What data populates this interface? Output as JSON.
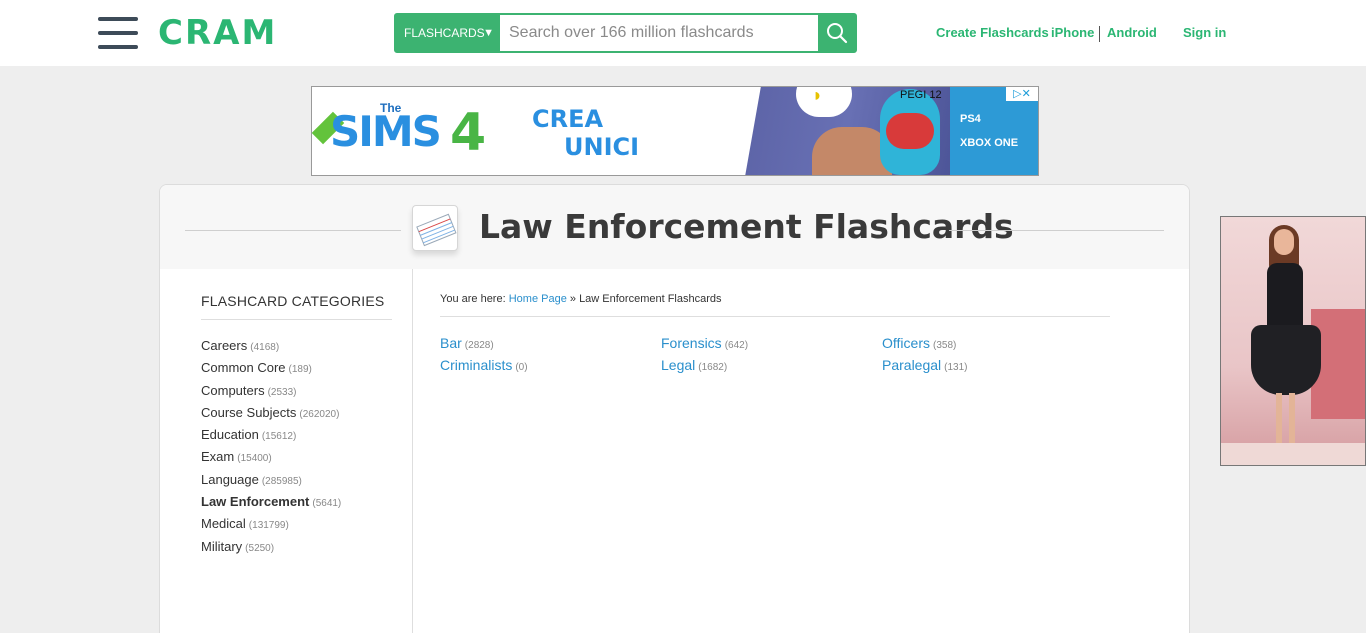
{
  "header": {
    "logo": "CRAM",
    "search_category": "FLASHCARDS",
    "search_placeholder": "Search over 166 million flashcards",
    "links": {
      "create": "Create Flashcards",
      "iphone": "iPhone",
      "android": "Android",
      "signin": "Sign in"
    }
  },
  "ad_banner": {
    "brand_the": "The",
    "brand_name": "SIMS",
    "brand_number": "4",
    "text_line1": "CREA",
    "text_line2": "UNICI",
    "rating": "PEGI 12",
    "platform1": "PS4",
    "platform2": "XBOX ONE"
  },
  "page": {
    "title": "Law Enforcement Flashcards"
  },
  "sidebar": {
    "title": "FLASHCARD CATEGORIES",
    "categories": [
      {
        "label": "Careers",
        "count": "(4168)"
      },
      {
        "label": "Common Core",
        "count": "(189)"
      },
      {
        "label": "Computers",
        "count": "(2533)"
      },
      {
        "label": "Course Subjects",
        "count": "(262020)"
      },
      {
        "label": "Education",
        "count": "(15612)"
      },
      {
        "label": "Exam",
        "count": "(15400)"
      },
      {
        "label": "Language",
        "count": "(285985)"
      },
      {
        "label": "Law Enforcement",
        "count": "(5641)"
      },
      {
        "label": "Medical",
        "count": "(131799)"
      },
      {
        "label": "Military",
        "count": "(5250)"
      }
    ]
  },
  "breadcrumb": {
    "prefix": "You are here:",
    "home": "Home Page",
    "separator": "»",
    "current": "Law Enforcement Flashcards"
  },
  "subcategories": [
    {
      "label": "Bar",
      "count": "(2828)"
    },
    {
      "label": "Criminalists",
      "count": "(0)"
    },
    {
      "label": "Forensics",
      "count": "(642)"
    },
    {
      "label": "Legal",
      "count": "(1682)"
    },
    {
      "label": "Officers",
      "count": "(358)"
    },
    {
      "label": "Paralegal",
      "count": "(131)"
    }
  ],
  "colors": {
    "brand_green": "#2bb673",
    "link_blue": "#2a8fcc"
  }
}
